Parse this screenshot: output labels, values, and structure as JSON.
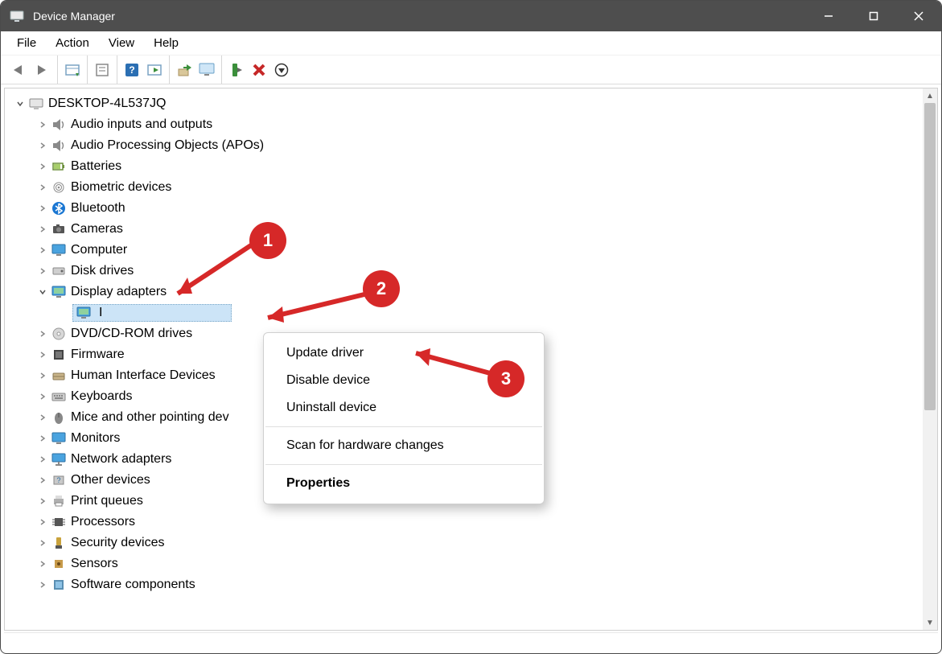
{
  "window": {
    "title": "Device Manager"
  },
  "menu": {
    "file": "File",
    "action": "Action",
    "view": "View",
    "help": "Help"
  },
  "toolbar_icons": {
    "back": "back-icon",
    "forward": "forward-icon",
    "show_hidden": "show-hidden-icon",
    "properties": "properties-icon",
    "help": "help-icon",
    "scan": "scan-icon",
    "update": "update-icon",
    "monitor": "monitor-icon",
    "install": "install-icon",
    "remove": "remove-icon",
    "down": "down-icon"
  },
  "tree": {
    "root": "DESKTOP-4L537JQ",
    "items": [
      {
        "label": "Audio inputs and outputs",
        "icon": "speaker-icon"
      },
      {
        "label": "Audio Processing Objects (APOs)",
        "icon": "speaker-icon"
      },
      {
        "label": "Batteries",
        "icon": "battery-icon"
      },
      {
        "label": "Biometric devices",
        "icon": "fingerprint-icon"
      },
      {
        "label": "Bluetooth",
        "icon": "bluetooth-icon"
      },
      {
        "label": "Cameras",
        "icon": "camera-icon"
      },
      {
        "label": "Computer",
        "icon": "monitor-icon"
      },
      {
        "label": "Disk drives",
        "icon": "disk-icon"
      },
      {
        "label": "Display adapters",
        "icon": "display-adapter-icon",
        "expanded": true,
        "child_label": "I"
      },
      {
        "label": "DVD/CD-ROM drives",
        "icon": "dvd-icon"
      },
      {
        "label": "Firmware",
        "icon": "firmware-icon"
      },
      {
        "label": "Human Interface Devices",
        "icon": "hid-icon"
      },
      {
        "label": "Keyboards",
        "icon": "keyboard-icon"
      },
      {
        "label": "Mice and other pointing dev",
        "icon": "mouse-icon"
      },
      {
        "label": "Monitors",
        "icon": "monitor-icon"
      },
      {
        "label": "Network adapters",
        "icon": "network-icon"
      },
      {
        "label": "Other devices",
        "icon": "other-icon"
      },
      {
        "label": "Print queues",
        "icon": "printer-icon"
      },
      {
        "label": "Processors",
        "icon": "processor-icon"
      },
      {
        "label": "Security devices",
        "icon": "security-icon"
      },
      {
        "label": "Sensors",
        "icon": "sensor-icon"
      },
      {
        "label": "Software components",
        "icon": "software-icon"
      }
    ]
  },
  "context_menu": {
    "update": "Update driver",
    "disable": "Disable device",
    "uninstall": "Uninstall device",
    "scan": "Scan for hardware changes",
    "properties": "Properties"
  },
  "annotations": {
    "step1": "1",
    "step2": "2",
    "step3": "3"
  }
}
